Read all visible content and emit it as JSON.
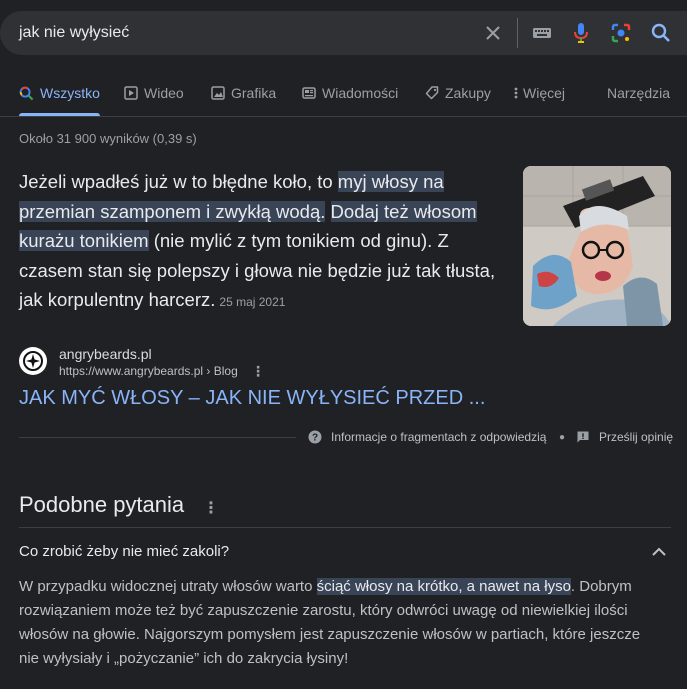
{
  "search": {
    "query": "jak nie wyłysieć"
  },
  "tabs": [
    {
      "label": "Wszystko",
      "icon": "search-icon",
      "active": true
    },
    {
      "label": "Wideo",
      "icon": "play-icon"
    },
    {
      "label": "Grafika",
      "icon": "image-icon"
    },
    {
      "label": "Wiadomości",
      "icon": "news-icon"
    },
    {
      "label": "Zakupy",
      "icon": "tag-icon"
    },
    {
      "label": "Więcej",
      "icon": "more-vert-icon"
    }
  ],
  "tools_label": "Narzędzia",
  "result_stats": "Około 31 900 wyników (0,39 s)",
  "snippet": {
    "parts": [
      "Jeżeli wpadłeś już w to błędne koło, to ",
      "myj włosy na przemian szamponem i zwykłą wodą.",
      " ",
      "Dodaj też włosom kurażu tonikiem",
      " (nie mylić z tym tonikiem od ginu). Z czasem stan się polepszy i głowa nie będzie już tak tłusta, jak korpulentny harcerz."
    ],
    "date": "25 maj 2021",
    "image_alt": "kobieta z tatuażami i tubką kosmetyku"
  },
  "source": {
    "site_name": "angrybeards.pl",
    "url": "https://www.angrybeards.pl",
    "breadcrumb": " › Blog",
    "title": "JAK MYĆ WŁOSY – JAK NIE WYŁYSIEĆ PRZED ..."
  },
  "footer": {
    "about_label": "Informacje o fragmentach z odpowiedzią",
    "feedback_label": "Prześlij opinię"
  },
  "people_also_ask": {
    "heading": "Podobne pytania",
    "question": "Co zrobić żeby nie mieć zakoli?",
    "answer_parts": [
      "W przypadku widocznej utraty włosów warto ",
      "ściąć włosy na krótko, a nawet na łyso",
      ". Dobrym rozwiązaniem może też być zapuszczenie zarostu, który odwróci uwagę od niewielkiej ilości włosów na głowie. Najgorszym pomysłem jest zapuszczenie włosów w partiach, które jeszcze nie wyłysiały i „pożyczanie” ich do zakrycia łysiny!"
    ]
  },
  "colors": {
    "background": "#202124",
    "link": "#8ab4f8",
    "highlight": "#394457"
  }
}
